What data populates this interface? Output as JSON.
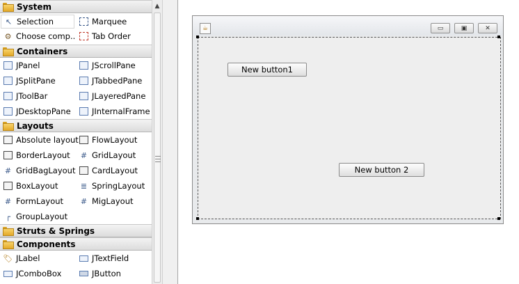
{
  "palette": {
    "categories": [
      {
        "label": "System"
      },
      {
        "label": "Containers"
      },
      {
        "label": "Layouts"
      },
      {
        "label": "Struts & Springs"
      },
      {
        "label": "Components"
      }
    ],
    "system": [
      "Selection",
      "Marquee",
      "Choose comp...",
      "Tab Order"
    ],
    "containers": [
      "JPanel",
      "JScrollPane",
      "JSplitPane",
      "JTabbedPane",
      "JToolBar",
      "JLayeredPane",
      "JDesktopPane",
      "JInternalFrame"
    ],
    "layouts": [
      "Absolute layout",
      "FlowLayout",
      "BorderLayout",
      "GridLayout",
      "GridBagLayout",
      "CardLayout",
      "BoxLayout",
      "SpringLayout",
      "FormLayout",
      "MigLayout",
      "GroupLayout"
    ],
    "components": [
      "JLabel",
      "JTextField",
      "JComboBox",
      "JButton"
    ],
    "selected_item": "Selection"
  },
  "design": {
    "buttons": [
      {
        "label": "New button1"
      },
      {
        "label": "New button 2"
      }
    ],
    "window_controls": {
      "minimize": "▭",
      "maximize": "▣",
      "close": "✕"
    }
  },
  "icons": {
    "folder": "folder-icon",
    "scroll_up": "▲",
    "arrow": "↖",
    "app": "☕"
  }
}
